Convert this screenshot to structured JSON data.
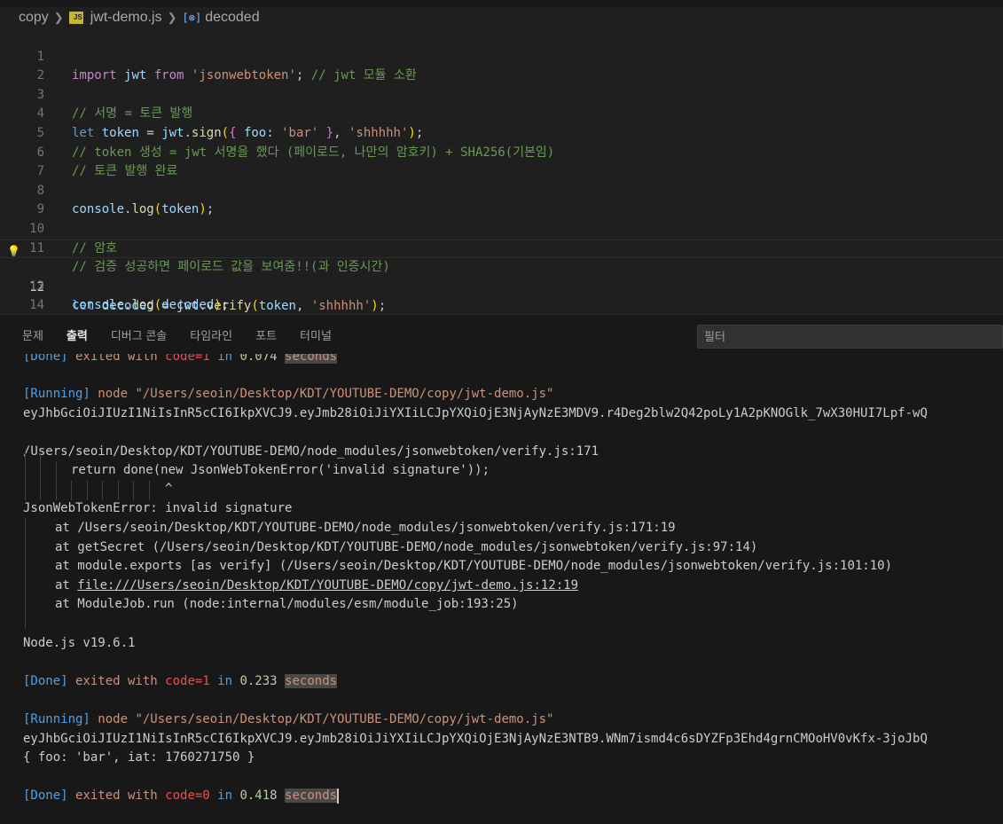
{
  "breadcrumb": {
    "folder": "copy",
    "file": "jwt-demo.js",
    "file_icon": "JS",
    "symbol": "decoded"
  },
  "editor": {
    "line_numbers": [
      "1",
      "2",
      "3",
      "4",
      "5",
      "6",
      "7",
      "8",
      "9",
      "10",
      "11",
      "12",
      "13",
      "14"
    ],
    "active_line": "12",
    "code": {
      "l1_import": "import",
      "l1_jwt": "jwt",
      "l1_from": "from",
      "l1_str": "'jsonwebtoken'",
      "l1_semi": ";",
      "l1_cmt": "// jwt 모듈 소환",
      "l3_cmt": "// 서명 = 토큰 발행",
      "l4_let": "let",
      "l4_token": "token",
      "l4_eq": " = ",
      "l4_jwt": "jwt",
      "l4_dot": ".",
      "l4_sign": "sign",
      "l4_open": "(",
      "l4_brace_open": "{",
      "l4_foo": " foo",
      "l4_colon": ": ",
      "l4_bar": "'bar'",
      "l4_brace_close": " }",
      "l4_comma": ", ",
      "l4_secret": "'shhhhh'",
      "l4_close": ")",
      "l4_semi": ";",
      "l5_cmt": "// token 생성 = jwt 서명을 했다 (페이로드, 나만의 암호키) + SHA256(기본임)",
      "l6_cmt": "// 토큰 발행 완료",
      "l8_console": "console",
      "l8_log": "log",
      "l8_token": "token",
      "l10_cmt": "// 암호",
      "l11_cmt": "// 검증 성공하면 페이로드 값을 보여줌!!(과 인증시간)",
      "l12_let": "let",
      "l12_decoded": "decoded",
      "l12_jwt": "jwt",
      "l12_verify": "verify",
      "l12_token": "token",
      "l12_secret": "'shhhhh'",
      "l13_console": "console",
      "l13_log": "log",
      "l13_decoded": "decoded"
    }
  },
  "panel": {
    "tabs": [
      "문제",
      "출력",
      "디버그 콘솔",
      "타임라인",
      "포트",
      "터미널"
    ],
    "active_tab": "출력",
    "filter_placeholder": "필터"
  },
  "output": {
    "done1": {
      "done": "[Done]",
      "exited": " exited with ",
      "code": "code=1",
      "in": " in ",
      "time": "0.074",
      "seconds": "seconds"
    },
    "running1": {
      "tag": "[Running]",
      "node": " node ",
      "path": "\"/Users/seoin/Desktop/KDT/YOUTUBE-DEMO/copy/jwt-demo.js\""
    },
    "token1": "eyJhbGciOiJIUzI1NiIsInR5cCI6IkpXVCJ9.eyJmb28iOiJiYXIiLCJpYXQiOjE3NjAyNzE3MDV9.r4Deg2blw2Q42poLy1A2pKNOGlk_7wX30HUI7Lpf-wQ",
    "err_path": "/Users/seoin/Desktop/KDT/YOUTUBE-DEMO/node_modules/jsonwebtoken/verify.js:171",
    "err_code": "return done(new JsonWebTokenError('invalid signature'));",
    "err_caret": "^",
    "err_name": "JsonWebTokenError: invalid signature",
    "stack": [
      "at /Users/seoin/Desktop/KDT/YOUTUBE-DEMO/node_modules/jsonwebtoken/verify.js:171:19",
      "at getSecret (/Users/seoin/Desktop/KDT/YOUTUBE-DEMO/node_modules/jsonwebtoken/verify.js:97:14)",
      "at module.exports [as verify] (/Users/seoin/Desktop/KDT/YOUTUBE-DEMO/node_modules/jsonwebtoken/verify.js:101:10)"
    ],
    "stack_at": "at ",
    "stack_link": "file:///Users/seoin/Desktop/KDT/YOUTUBE-DEMO/copy/jwt-demo.js:12:19",
    "stack_last": "at ModuleJob.run (node:internal/modules/esm/module_job:193:25)",
    "node_version": "Node.js v19.6.1",
    "done2": {
      "done": "[Done]",
      "exited": " exited with ",
      "code": "code=1",
      "in": " in ",
      "time": "0.233",
      "seconds": "seconds"
    },
    "running2": {
      "tag": "[Running]",
      "node": " node ",
      "path": "\"/Users/seoin/Desktop/KDT/YOUTUBE-DEMO/copy/jwt-demo.js\""
    },
    "token2": "eyJhbGciOiJIUzI1NiIsInR5cCI6IkpXVCJ9.eyJmb28iOiJiYXIiLCJpYXQiOjE3NjAyNzE3NTB9.WNm7ismd4c6sDYZFp3Ehd4grnCMOoHV0vKfx-3joJbQ",
    "result": "{ foo: 'bar', iat: 1760271750 }",
    "done3": {
      "done": "[Done]",
      "exited": " exited with ",
      "code": "code=0",
      "in": " in ",
      "time": "0.418",
      "seconds": "seconds"
    }
  }
}
